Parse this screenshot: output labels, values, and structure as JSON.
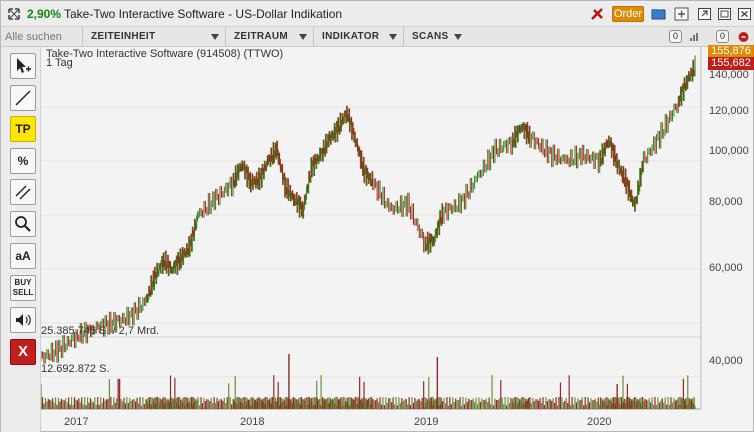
{
  "window": {
    "change_pct": "2,90%",
    "title": "Take-Two Interactive Software - US-Dollar Indikation",
    "order_label": "Order"
  },
  "toolbar": {
    "search_placeholder": "Alle suchen",
    "menus": [
      {
        "label": "ZEITEINHEIT"
      },
      {
        "label": "ZEITRAUM"
      },
      {
        "label": "INDIKATOR"
      },
      {
        "label": "SCANS"
      }
    ],
    "badge_a": "0",
    "badge_b": "0"
  },
  "tools": [
    {
      "name": "cursor-tool",
      "label": ""
    },
    {
      "name": "line-tool",
      "label": ""
    },
    {
      "name": "tp-tool",
      "label": "TP"
    },
    {
      "name": "percent-tool",
      "label": "%"
    },
    {
      "name": "parallel-tool",
      "label": ""
    },
    {
      "name": "zoom-tool",
      "label": ""
    },
    {
      "name": "font-size-tool",
      "label": "aA"
    },
    {
      "name": "buy-sell-tool",
      "label": "BUY SELL"
    },
    {
      "name": "sound-tool",
      "label": ""
    },
    {
      "name": "close-tool",
      "label": "X"
    }
  ],
  "chart_data": {
    "type": "line",
    "title": "Take-Two Interactive Software (914508) (TTWO)",
    "subtitle": "1 Tag",
    "price_high": "155,876",
    "price_low": "155,682",
    "volume_label_1": "25.385.745 S. / 2,7 Mrd.",
    "volume_label_2": "12.692.872 S.",
    "y_ticks": [
      "140,000",
      "120,000",
      "100,000",
      "80,000",
      "60,000",
      "40,000"
    ],
    "x_ticks": [
      "2017",
      "2018",
      "2019",
      "2020"
    ],
    "ylim": [
      40,
      160
    ],
    "series": [
      {
        "values": [
          [
            2016.8,
            47
          ],
          [
            2016.9,
            50
          ],
          [
            2017.0,
            55
          ],
          [
            2017.1,
            58
          ],
          [
            2017.2,
            60
          ],
          [
            2017.3,
            62
          ],
          [
            2017.4,
            68
          ],
          [
            2017.45,
            77
          ],
          [
            2017.5,
            83
          ],
          [
            2017.55,
            80
          ],
          [
            2017.6,
            84
          ],
          [
            2017.65,
            88
          ],
          [
            2017.7,
            100
          ],
          [
            2017.8,
            106
          ],
          [
            2017.9,
            112
          ],
          [
            2017.95,
            119
          ],
          [
            2018.0,
            112
          ],
          [
            2018.05,
            113
          ],
          [
            2018.1,
            120
          ],
          [
            2018.15,
            124
          ],
          [
            2018.2,
            110
          ],
          [
            2018.25,
            106
          ],
          [
            2018.3,
            102
          ],
          [
            2018.35,
            118
          ],
          [
            2018.4,
            122
          ],
          [
            2018.45,
            128
          ],
          [
            2018.5,
            132
          ],
          [
            2018.55,
            138
          ],
          [
            2018.6,
            128
          ],
          [
            2018.65,
            116
          ],
          [
            2018.7,
            112
          ],
          [
            2018.8,
            102
          ],
          [
            2018.9,
            104
          ],
          [
            2019.0,
            89
          ],
          [
            2019.05,
            91
          ],
          [
            2019.1,
            101
          ],
          [
            2019.2,
            104
          ],
          [
            2019.3,
            114
          ],
          [
            2019.4,
            124
          ],
          [
            2019.5,
            127
          ],
          [
            2019.55,
            133
          ],
          [
            2019.6,
            129
          ],
          [
            2019.7,
            123
          ],
          [
            2019.8,
            120
          ],
          [
            2019.9,
            122
          ],
          [
            2020.0,
            120
          ],
          [
            2020.05,
            128
          ],
          [
            2020.1,
            119
          ],
          [
            2020.15,
            112
          ],
          [
            2020.2,
            103
          ],
          [
            2020.25,
            120
          ],
          [
            2020.35,
            130
          ],
          [
            2020.45,
            142
          ],
          [
            2020.5,
            150
          ],
          [
            2020.55,
            155
          ]
        ]
      }
    ]
  },
  "colors": {
    "up": "#1f8a1f",
    "down": "#b81616",
    "grid": "#e3e3e3",
    "price_high_bg": "#e08a00",
    "price_low_bg": "#c11e1e"
  }
}
